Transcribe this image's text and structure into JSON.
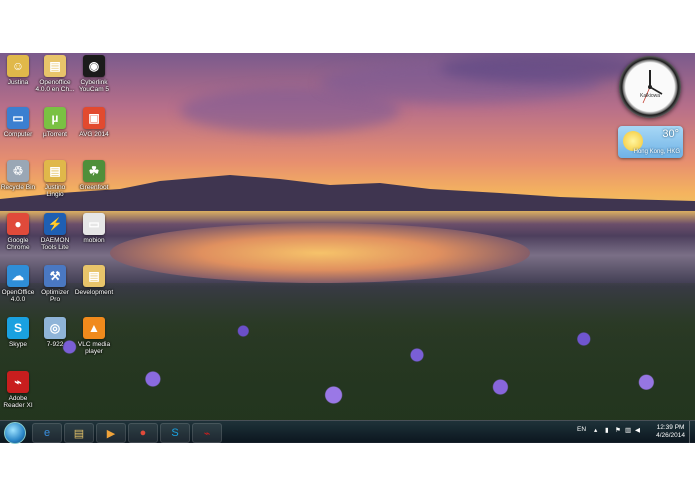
{
  "desktop_icons": [
    {
      "label": "Justina",
      "color": "#e0b84a",
      "glyph": "☺"
    },
    {
      "label": "Openoffice\n4.0.0 en Ch...",
      "color": "#e8c46a",
      "glyph": "▤"
    },
    {
      "label": "Cyberlink\nYouCam 5",
      "color": "#1b1b1b",
      "glyph": "◉"
    },
    {
      "label": "Computer",
      "color": "#3b7fd0",
      "glyph": "▭"
    },
    {
      "label": "µTorrent",
      "color": "#7ac143",
      "glyph": "µ"
    },
    {
      "label": "AVG 2014",
      "color": "#e24a2f",
      "glyph": "▣"
    },
    {
      "label": "Recycle Bin",
      "color": "#9aa7b5",
      "glyph": "♲"
    },
    {
      "label": "Justino\nLingio",
      "color": "#e0b84a",
      "glyph": "▤"
    },
    {
      "label": "Greenfoot",
      "color": "#4f8f3a",
      "glyph": "☘"
    },
    {
      "label": "Google\nChrome",
      "color": "#e04a3a",
      "glyph": "●"
    },
    {
      "label": "DAEMON\nTools Lite",
      "color": "#1e5fb3",
      "glyph": "⚡"
    },
    {
      "label": "mobion",
      "color": "#e6e6e6",
      "glyph": "▭"
    },
    {
      "label": "OpenOffice\n4.0.0",
      "color": "#2f8ed8",
      "glyph": "☁"
    },
    {
      "label": "Optimizer\nPro",
      "color": "#4a78c2",
      "glyph": "⚒"
    },
    {
      "label": "Development",
      "color": "#e8c46a",
      "glyph": "▤"
    },
    {
      "label": "Skype",
      "color": "#1aa1e0",
      "glyph": "S"
    },
    {
      "label": "7-922",
      "color": "#8fb4d8",
      "glyph": "◎"
    },
    {
      "label": "VLC media\nplayer",
      "color": "#f08a1c",
      "glyph": "▲"
    },
    {
      "label": "Adobe\nReader XI",
      "color": "#c81e1e",
      "glyph": "⌁"
    }
  ],
  "gadgets": {
    "clock_brand": "Kalkiowa",
    "weather_temp": "30°",
    "weather_city": "Hong Kong, HKG"
  },
  "taskbar": {
    "apps": [
      {
        "name": "internet-explorer",
        "glyph": "e",
        "color": "#3a8fe0"
      },
      {
        "name": "file-explorer",
        "glyph": "▤",
        "color": "#e6c46a"
      },
      {
        "name": "media-player",
        "glyph": "▶",
        "color": "#f0a33a"
      },
      {
        "name": "chrome",
        "glyph": "●",
        "color": "#e04a3a"
      },
      {
        "name": "skype",
        "glyph": "S",
        "color": "#1aa1e0"
      },
      {
        "name": "adobe-reader",
        "glyph": "⌁",
        "color": "#c81e1e"
      }
    ],
    "language": "EN",
    "time": "12:39 PM",
    "date": "4/26/2014"
  }
}
